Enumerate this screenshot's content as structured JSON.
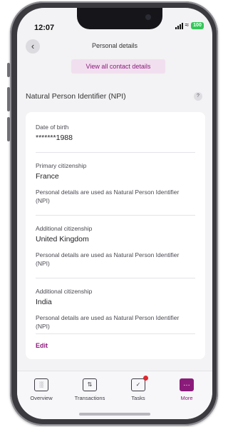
{
  "status_bar": {
    "time": "12:07",
    "battery": "100"
  },
  "header": {
    "title": "Personal details"
  },
  "view_all_label": "View all contact details",
  "section": {
    "title": "Natural Person Identifier (NPI)"
  },
  "details": {
    "date_of_birth": {
      "label": "Date of birth",
      "value": "*******1988"
    },
    "primary_citizenship": {
      "label": "Primary citizenship",
      "value": "France",
      "note": "Personal details are used as Natural Person Identifier (NPI)"
    },
    "additional_citizenships": [
      {
        "label": "Additional citizenship",
        "value": "United Kingdom",
        "note": "Personal details are used as Natural Person Identifier (NPI)"
      },
      {
        "label": "Additional citizenship",
        "value": "India",
        "note": "Personal details are used as Natural Person Identifier (NPI)"
      }
    ],
    "edit_label": "Edit"
  },
  "tabs": [
    {
      "label": "Overview",
      "icon": "overview-icon"
    },
    {
      "label": "Transactions",
      "icon": "transactions-icon"
    },
    {
      "label": "Tasks",
      "icon": "tasks-icon",
      "has_notification": true
    },
    {
      "label": "More",
      "icon": "more-icon",
      "active": true
    }
  ],
  "colors": {
    "accent": "#8b1b7a",
    "notification": "#e0272f",
    "battery": "#34c759"
  }
}
